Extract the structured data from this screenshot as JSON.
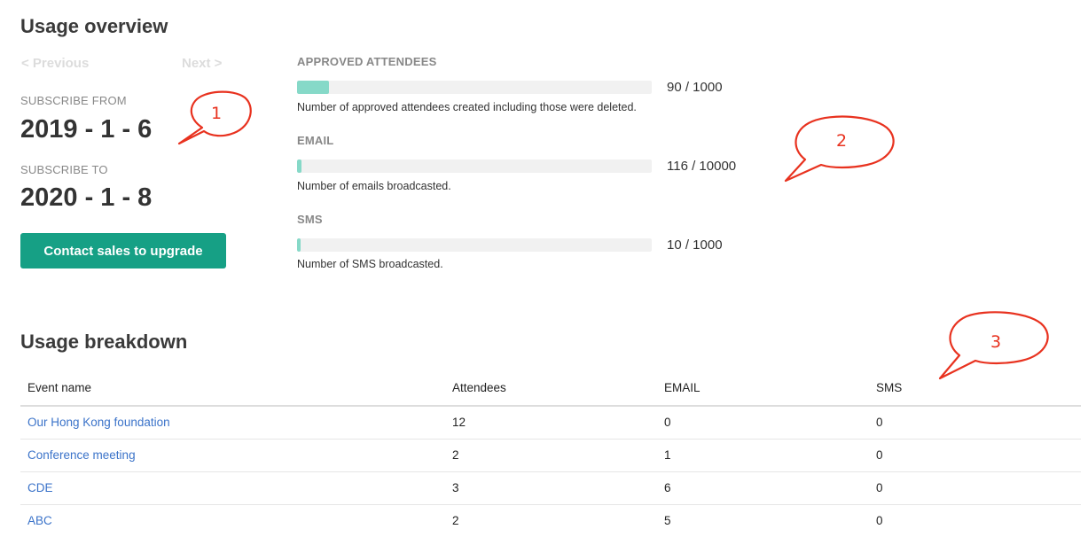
{
  "overview": {
    "title": "Usage overview",
    "pager": {
      "previous": "< Previous",
      "next": "Next >"
    },
    "subscribe_from_label": "SUBSCRIBE FROM",
    "subscribe_from": "2019 - 1 - 6",
    "subscribe_to_label": "SUBSCRIBE TO",
    "subscribe_to": "2020 - 1 - 8",
    "upgrade_button": "Contact sales to upgrade"
  },
  "metrics": [
    {
      "title": "APPROVED ATTENDEES",
      "value_text": "90 / 1000",
      "used": 90,
      "limit": 1000,
      "description": "Number of approved attendees created including those were deleted."
    },
    {
      "title": "EMAIL",
      "value_text": "116 / 10000",
      "used": 116,
      "limit": 10000,
      "description": "Number of emails broadcasted."
    },
    {
      "title": "SMS",
      "value_text": "10 / 1000",
      "used": 10,
      "limit": 1000,
      "description": "Number of SMS broadcasted."
    }
  ],
  "annotations": [
    "1",
    "2",
    "3"
  ],
  "breakdown": {
    "title": "Usage breakdown",
    "columns": [
      "Event name",
      "Attendees",
      "EMAIL",
      "SMS"
    ],
    "rows": [
      [
        "Our Hong Kong foundation",
        "12",
        "0",
        "0"
      ],
      [
        "Conference meeting",
        "2",
        "1",
        "0"
      ],
      [
        "CDE",
        "3",
        "6",
        "0"
      ],
      [
        "ABC",
        "2",
        "5",
        "0"
      ]
    ]
  },
  "colors": {
    "accent": "#16a085",
    "bar_fill": "#86d9c8",
    "link": "#3b73c9",
    "annotation": "#e8321f"
  }
}
